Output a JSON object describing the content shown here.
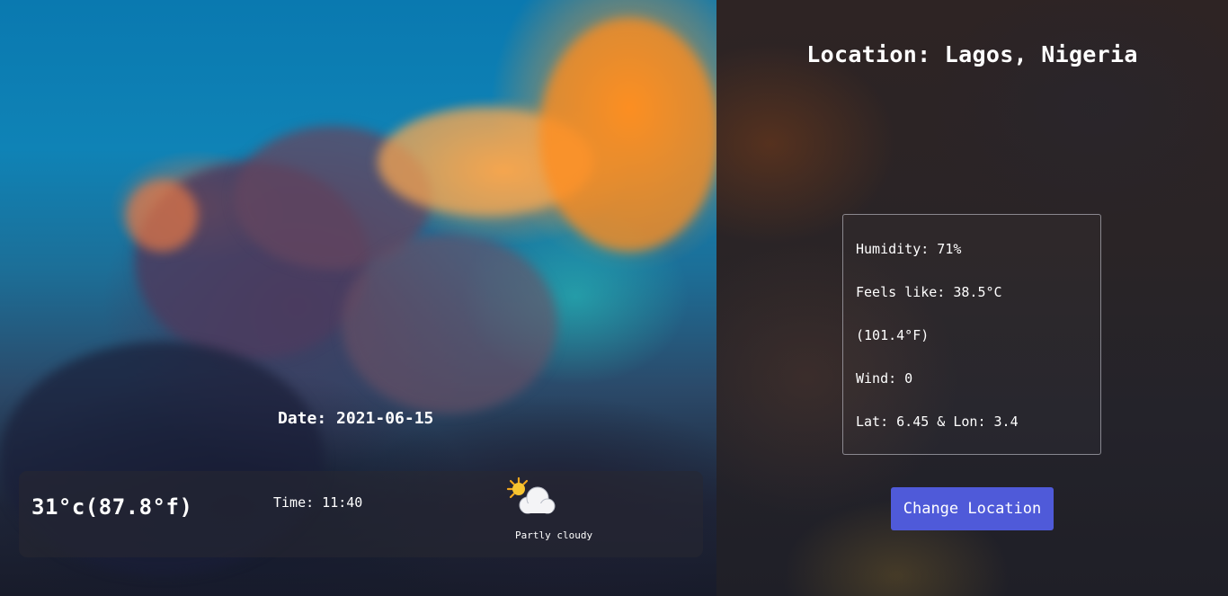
{
  "location": {
    "title": "Location: Lagos, Nigeria"
  },
  "current": {
    "date": "Date: 2021-06-15",
    "temperature": "31°c(87.8°f)",
    "time": "Time: 11:40",
    "condition": "Partly cloudy",
    "condition_icon": "partly-cloudy-icon"
  },
  "details": {
    "humidity": "Humidity: 71%",
    "feels_like": "Feels like: 38.5°C",
    "feels_like_f": "(101.4°F)",
    "wind": "Wind: 0",
    "coords": "Lat: 6.45 & Lon: 3.4"
  },
  "actions": {
    "change_location": "Change Location"
  },
  "colors": {
    "button": "#4f5ad9",
    "text": "#ffffff"
  }
}
